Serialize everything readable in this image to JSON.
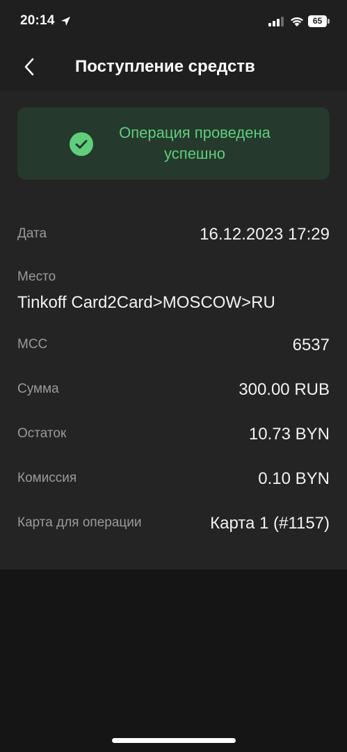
{
  "status_bar": {
    "time": "20:14",
    "battery": "65"
  },
  "header": {
    "title": "Поступление средств"
  },
  "banner": {
    "text_line1": "Операция проведена",
    "text_line2": "успешно"
  },
  "details": {
    "date_label": "Дата",
    "date_value": "16.12.2023 17:29",
    "place_label": "Место",
    "place_value": "Tinkoff Card2Card>MOSCOW>RU",
    "mcc_label": "MCC",
    "mcc_value": "6537",
    "amount_label": "Сумма",
    "amount_value": "300.00 RUB",
    "balance_label": "Остаток",
    "balance_value": "10.73 BYN",
    "fee_label": "Комиссия",
    "fee_value": "0.10 BYN",
    "card_label": "Карта для операции",
    "card_value": "Карта 1 (#1157)"
  },
  "colors": {
    "success_green": "#5fcf7c",
    "banner_bg": "#25392d",
    "panel_bg": "#242424",
    "page_bg": "#151515"
  }
}
